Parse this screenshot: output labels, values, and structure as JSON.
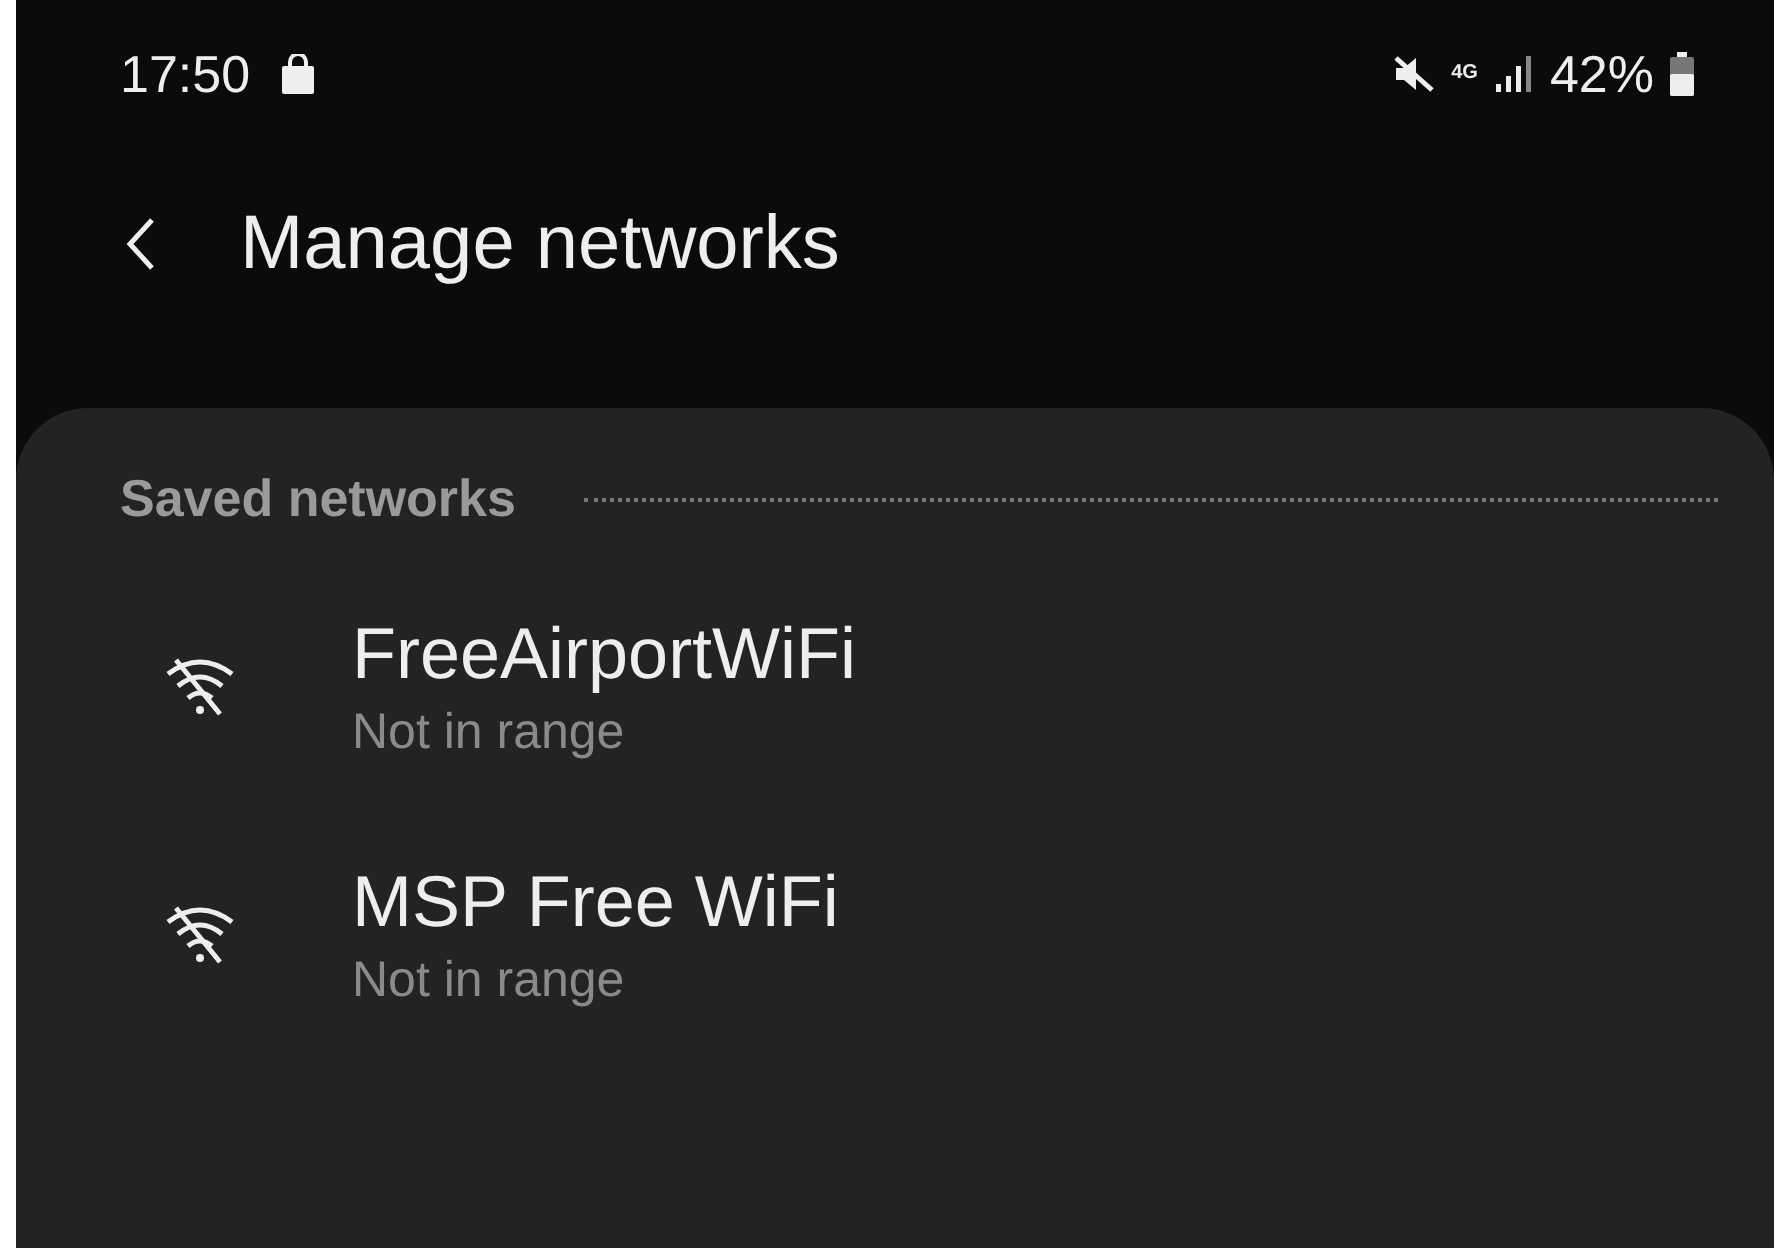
{
  "status_bar": {
    "time": "17:50",
    "network_type": "4G",
    "battery": "42%"
  },
  "header": {
    "title": "Manage networks"
  },
  "section": {
    "title": "Saved networks"
  },
  "networks": [
    {
      "name": "FreeAirportWiFi",
      "status": "Not in range"
    },
    {
      "name": "MSP Free WiFi",
      "status": "Not in range"
    }
  ]
}
